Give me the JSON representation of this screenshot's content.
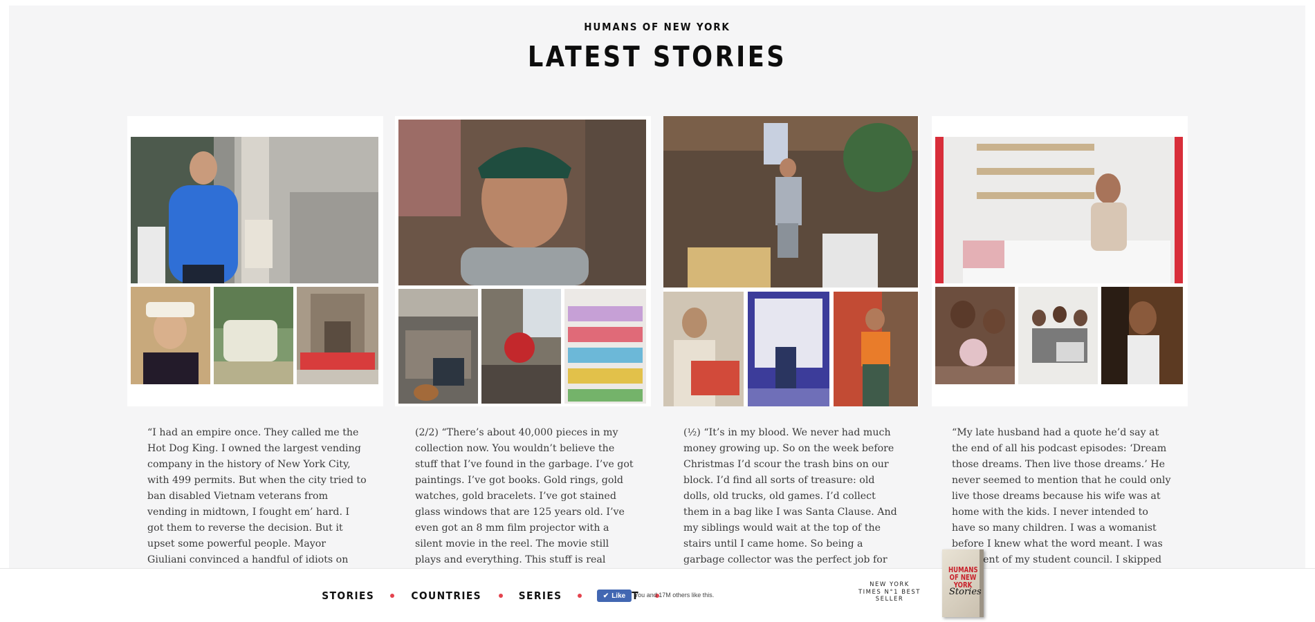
{
  "header": {
    "site": "HUMANS OF NEW YORK",
    "title": "LATEST STORIES"
  },
  "stories": [
    {
      "caption": "“I had an empire once. They called me the Hot Dog King. I owned the largest vending company in the history of New York City, with 499 permits. But when the city tried to ban disabled Vietnam veterans from vending in midtown, I fought em’ hard. I got them to reverse the decision. But it upset some powerful people. Mayor Giuliani convinced a handful of idiots on the city council to change"
    },
    {
      "caption": "(2/2) “There’s about 40,000 pieces in my collection now. You wouldn’t believe the stuff that I’ve found in the garbage. I’ve got paintings. I’ve got books. Gold rings, gold watches, gold bracelets. I’ve got stained glass windows that are 125 years old. I’ve even got an 8 mm film projector with a silent movie in the reel. The movie still plays and everything. This stuff is real treasure. But after awhile my"
    },
    {
      "caption": "(½) “It’s in my blood. We never had much money growing up. So on the week before Christmas I’d scour the trash bins on our block. I’d find all sorts of treasure: old dolls, old trucks, old games. I’d collect them in a bag like I was Santa Clause. And my siblings would wait at the top of the stairs until I came home. So being a garbage collector was the perfect job for me. It made sense. I’ve always"
    },
    {
      "caption": "“My late husband had a quote he’d say at the end of all his podcast episodes: ‘Dream those dreams. Then live those dreams.’ He never seemed to mention that he could only live those dreams because his wife was at home with the kids. I never intended to have so many children. I was a womanist before I knew what the word meant. I was president of my student council. I skipped three grades in"
    }
  ],
  "nav": {
    "stories": "STORIES",
    "countries": "COUNTRIES",
    "series": "SERIES",
    "about": "ABOUT"
  },
  "facebook": {
    "button": "Like",
    "text": "You and 17M others like this."
  },
  "promo": {
    "line1": "NEW YORK",
    "line2": "TIMES N°1 BEST",
    "line3": "SELLER",
    "book_title": "HUMANS OF NEW YORK",
    "book_subtitle": "Stories"
  },
  "colors": {
    "background": "#f5f5f6",
    "accent_dot": "#e4434e",
    "facebook": "#4267b2"
  }
}
